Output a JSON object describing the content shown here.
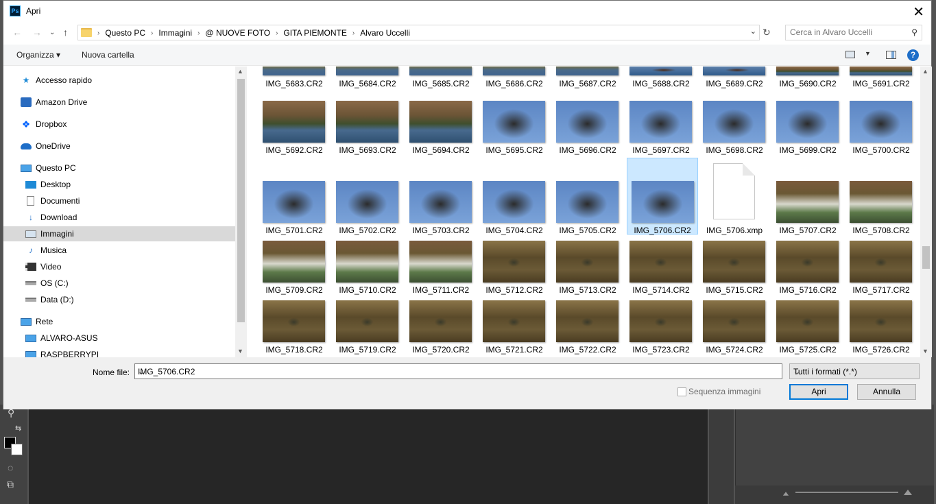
{
  "dialog": {
    "title": "Apri",
    "app_logo": "Ps"
  },
  "address": {
    "crumbs": [
      "Questo PC",
      "Immagini",
      "@ NUOVE FOTO",
      "GITA PIEMONTE",
      "Alvaro Uccelli"
    ]
  },
  "search": {
    "placeholder": "Cerca in Alvaro Uccelli"
  },
  "commands": {
    "organize": "Organizza ▾",
    "new_folder": "Nuova cartella"
  },
  "navpane": {
    "items": [
      {
        "label": "Accesso rapido",
        "icon": "star-icon"
      },
      {
        "label": "Amazon Drive",
        "icon": "amazon-drive-icon"
      },
      {
        "label": "Dropbox",
        "icon": "dropbox-icon"
      },
      {
        "label": "OneDrive",
        "icon": "cloud-icon"
      },
      {
        "label": "Questo PC",
        "icon": "computer-icon"
      },
      {
        "label": "Desktop",
        "icon": "desktop-icon"
      },
      {
        "label": "Documenti",
        "icon": "document-icon"
      },
      {
        "label": "Download",
        "icon": "download-icon"
      },
      {
        "label": "Immagini",
        "icon": "pictures-icon"
      },
      {
        "label": "Musica",
        "icon": "music-icon"
      },
      {
        "label": "Video",
        "icon": "video-icon"
      },
      {
        "label": "OS (C:)",
        "icon": "drive-icon"
      },
      {
        "label": "Data (D:)",
        "icon": "drive-icon"
      },
      {
        "label": "Rete",
        "icon": "network-icon"
      },
      {
        "label": "ALVARO-ASUS",
        "icon": "computer-icon"
      },
      {
        "label": "RASPBERRYPI",
        "icon": "computer-icon"
      }
    ]
  },
  "files": {
    "row0": [
      "IMG_5683.CR2",
      "IMG_5684.CR2",
      "IMG_5685.CR2",
      "IMG_5686.CR2",
      "IMG_5687.CR2",
      "IMG_5688.CR2",
      "IMG_5689.CR2",
      "IMG_5690.CR2",
      "IMG_5691.CR2"
    ],
    "row1": [
      "IMG_5692.CR2",
      "IMG_5693.CR2",
      "IMG_5694.CR2",
      "IMG_5695.CR2",
      "IMG_5696.CR2",
      "IMG_5697.CR2",
      "IMG_5698.CR2",
      "IMG_5699.CR2",
      "IMG_5700.CR2"
    ],
    "row2": [
      "IMG_5701.CR2",
      "IMG_5702.CR2",
      "IMG_5703.CR2",
      "IMG_5704.CR2",
      "IMG_5705.CR2",
      "IMG_5706.CR2",
      "IMG_5706.xmp",
      "IMG_5707.CR2",
      "IMG_5708.CR2"
    ],
    "row3": [
      "IMG_5709.CR2",
      "IMG_5710.CR2",
      "IMG_5711.CR2",
      "IMG_5712.CR2",
      "IMG_5713.CR2",
      "IMG_5714.CR2",
      "IMG_5715.CR2",
      "IMG_5716.CR2",
      "IMG_5717.CR2"
    ],
    "row4": [
      "IMG_5718.CR2",
      "IMG_5719.CR2",
      "IMG_5720.CR2",
      "IMG_5721.CR2",
      "IMG_5722.CR2",
      "IMG_5723.CR2",
      "IMG_5724.CR2",
      "IMG_5725.CR2",
      "IMG_5726.CR2"
    ],
    "selected": "IMG_5706.CR2"
  },
  "bottom": {
    "filename_label": "Nome file:",
    "filename_value": "IMG_5706.CR2",
    "filetype": "Tutti i formati (*.*)",
    "sequence_label": "Sequenza immagini",
    "sequence_checked": false,
    "open_label": "Apri",
    "cancel_label": "Annulla"
  }
}
